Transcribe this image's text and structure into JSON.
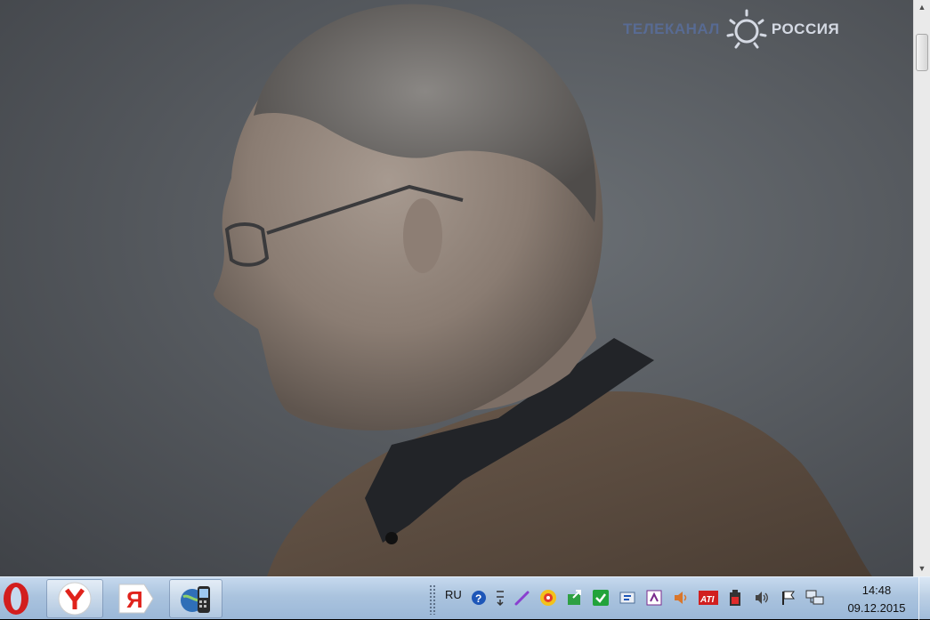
{
  "video": {
    "channel_logo": "РОССИЯ",
    "channel_logo_faded": "ТЕЛЕКАНАЛ"
  },
  "scrollbar": {
    "up_arrow_icon": "scroll-up-arrow",
    "down_arrow_icon": "scroll-down-arrow"
  },
  "taskbar": {
    "pinned_apps": [
      {
        "name": "Opera",
        "icon": "opera-icon"
      },
      {
        "name": "Yandex Browser",
        "icon": "yandex-browser-icon"
      },
      {
        "name": "Yandex",
        "icon": "yandex-icon"
      },
      {
        "name": "Phone / Network app",
        "icon": "phone-globe-icon"
      }
    ],
    "language": "RU",
    "tray_icons": [
      "help-icon",
      "network-activity-icon",
      "pen-icon",
      "smiley-icon",
      "green-update-icon",
      "green-check-icon",
      "shield-icon",
      "calendar-icon",
      "speaker-icon",
      "ati-icon",
      "battery-icon",
      "volume-icon",
      "flag-icon",
      "network-icon"
    ],
    "ati_label": "ATI",
    "clock_time": "14:48",
    "clock_date": "09.12.2015",
    "accent_color": "#9bb8d8"
  }
}
